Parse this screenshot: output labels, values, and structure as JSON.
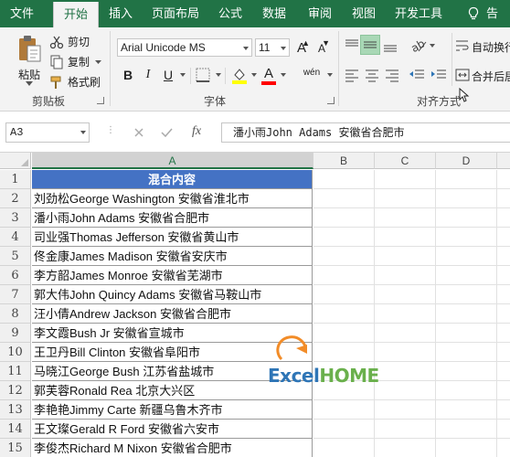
{
  "ribbon_tabs": [
    "文件",
    "开始",
    "插入",
    "页面布局",
    "公式",
    "数据",
    "审阅",
    "视图",
    "开发工具"
  ],
  "active_tab": "开始",
  "help_label": "告",
  "clipboard": {
    "paste_label": "粘贴",
    "cut_label": "剪切",
    "copy_label": "复制",
    "format_painter_label": "格式刷",
    "group_label": "剪贴板"
  },
  "font": {
    "font_name": "Arial Unicode MS",
    "font_size": "11",
    "grow_label": "A",
    "shrink_label": "A",
    "bold": "B",
    "italic": "I",
    "underline": "U",
    "font_color_label": "A",
    "phonetic_label": "wén",
    "group_label": "字体",
    "colors": {
      "highlight": "#ffff00",
      "font_color": "#ff0000"
    }
  },
  "alignment": {
    "wrap_text_label": "自动换行",
    "merge_label": "合并后居",
    "group_label": "对齐方式"
  },
  "formula_bar": {
    "name_box": "A3",
    "fx_label": "fx",
    "formula": "潘小雨John Adams 安徽省合肥市"
  },
  "sheet": {
    "columns": [
      "A",
      "B",
      "C",
      "D"
    ],
    "selected_column": "A",
    "rows": [
      "1",
      "2",
      "3",
      "4",
      "5",
      "6",
      "7",
      "8",
      "9",
      "10",
      "11",
      "12",
      "13",
      "14",
      "15"
    ],
    "header_cell": "混合内容",
    "cells": [
      "刘劲松George Washington 安徽省淮北市",
      "潘小雨John Adams 安徽省合肥市",
      "司业强Thomas Jefferson 安徽省黄山市",
      "佟金康James Madison 安徽省安庆市",
      "李方韶James Monroe 安徽省芜湖市",
      "郭大伟John Quincy Adams 安徽省马鞍山市",
      "汪小倩Andrew Jackson 安徽省合肥市",
      "李文霞Bush Jr 安徽省宣城市",
      "王卫丹Bill Clinton 安徽省阜阳市",
      "马晓江George Bush 江苏省盐城市",
      "郭芙蓉Ronald Rea 北京大兴区",
      "李艳艳Jimmy Carte 新疆乌鲁木齐市",
      "王文璨Gerald R Ford 安徽省六安市",
      "李俊杰Richard M Nixon 安徽省合肥市"
    ],
    "header_fill": "#4472c4"
  },
  "watermark": {
    "part1": "Excel",
    "part2": "HOME"
  },
  "theme": {
    "accent": "#217346"
  }
}
